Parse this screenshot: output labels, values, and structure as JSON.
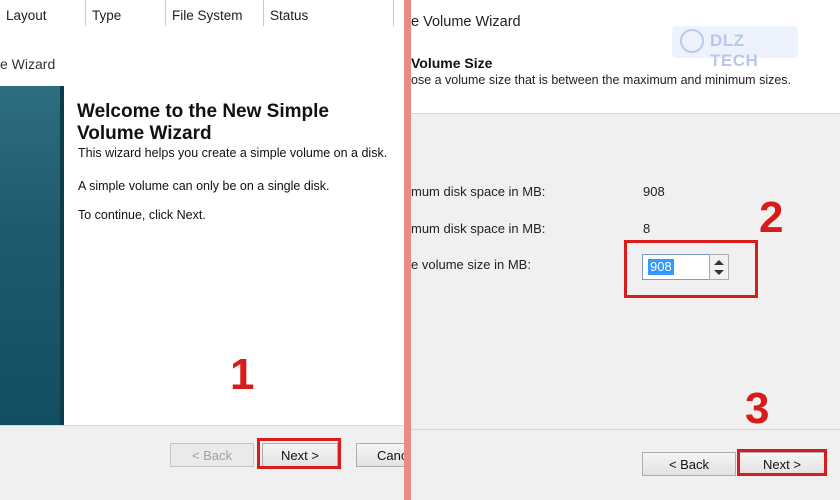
{
  "left": {
    "columns": [
      "Layout",
      "Type",
      "File System",
      "Status"
    ],
    "window_title": "e Wizard",
    "heading": "Welcome to the New Simple Volume Wizard",
    "para1": "This wizard helps you create a simple volume on a disk.",
    "para2": "A simple volume can only be on a single disk.",
    "para3": "To continue, click Next.",
    "back_label": "< Back",
    "next_label": "Next >",
    "cancel_label": "Canc",
    "step_marker": "1"
  },
  "right": {
    "window_title": "e Volume Wizard",
    "heading": "Volume Size",
    "subtitle": "ose a volume size that is between the maximum and minimum sizes.",
    "max_label": "mum disk space in MB:",
    "max_value": "908",
    "min_label": "mum disk space in MB:",
    "min_value": "8",
    "size_label": "e volume size in MB:",
    "size_value": "908",
    "back_label": "< Back",
    "next_label": "Next >",
    "step_marker_size": "2",
    "step_marker_next": "3"
  },
  "watermark": {
    "text": "DLZ TECH"
  },
  "colors": {
    "highlight": "#d81c1c",
    "divider": "#e98d83",
    "selection": "#3399ff",
    "sidebar": "#1d5a6c"
  }
}
